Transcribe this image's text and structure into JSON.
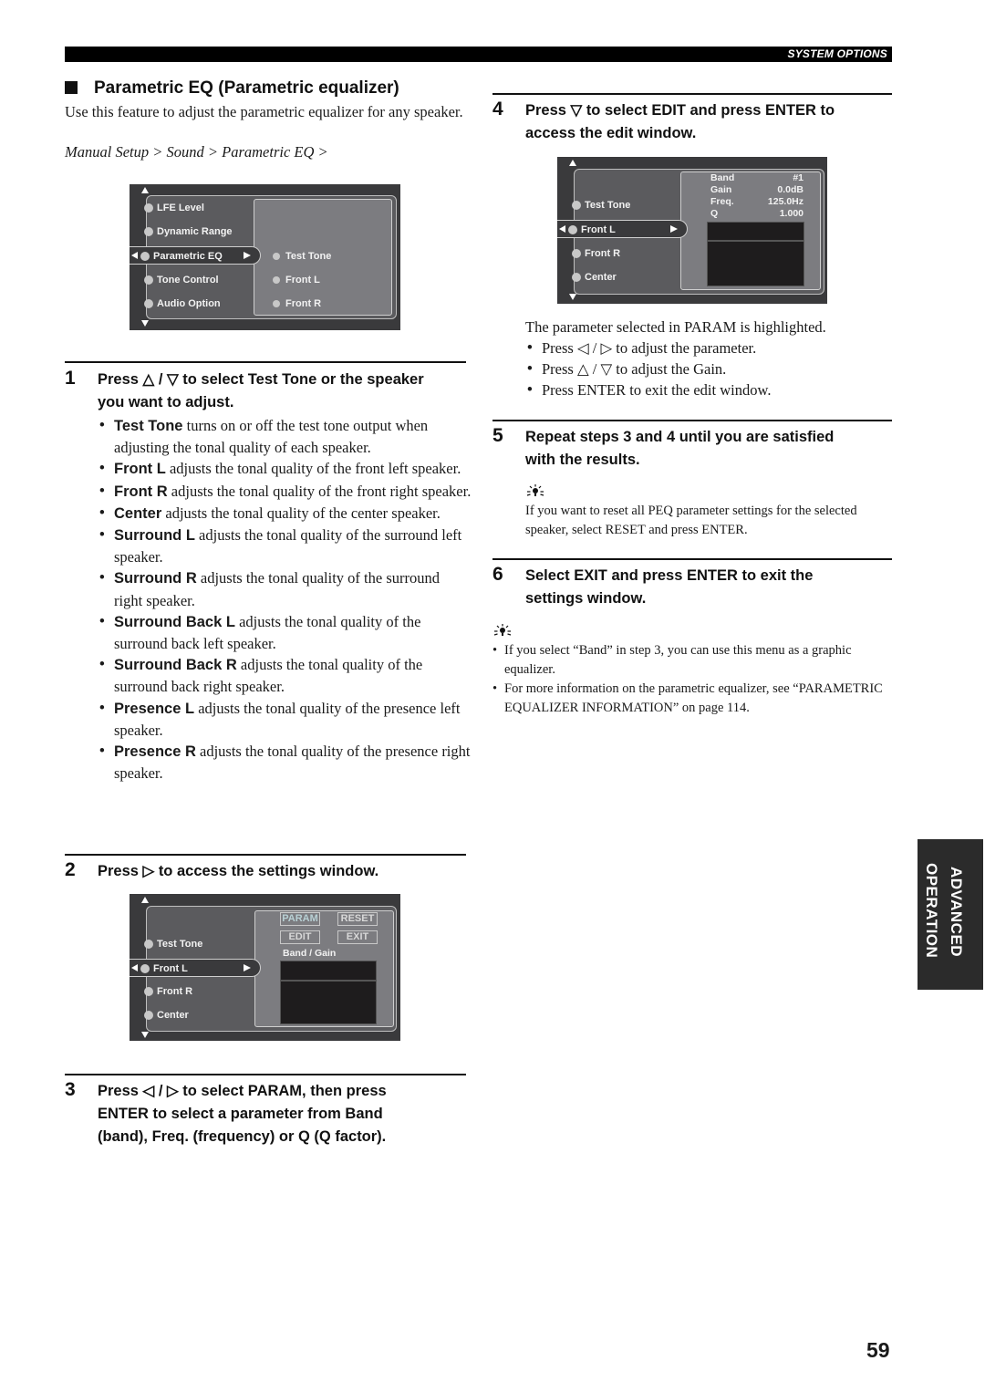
{
  "header": {
    "section_label": "SYSTEM OPTIONS"
  },
  "section": {
    "title": "Parametric EQ (Parametric equalizer)",
    "intro": "Use this feature to adjust the parametric equalizer for any speaker.",
    "breadcrumb": "Manual Setup > Sound > Parametric EQ >"
  },
  "osd_menu": {
    "left_items": [
      "LFE Level",
      "Dynamic Range",
      "Parametric EQ",
      "Tone Control",
      "Audio Option"
    ],
    "selected_index": 2,
    "right_items": [
      "Test Tone",
      "Front L",
      "Front R"
    ]
  },
  "steps": [
    {
      "num": "1",
      "text": "Press △ / ▽ to select Test Tone or the speaker you want to adjust.",
      "line1": "Press △ / ▽ to select Test Tone or the speaker",
      "line2": "you want to adjust.",
      "bullets": [
        {
          "term": "Test Tone",
          "desc": " turns on or off the test tone output when adjusting the tonal quality of each speaker."
        },
        {
          "term": "Front L",
          "desc": " adjusts the tonal quality of the front left speaker."
        },
        {
          "term": "Front R",
          "desc": " adjusts the tonal quality of the front right speaker."
        },
        {
          "term": "Center",
          "desc": " adjusts the tonal quality of the center speaker."
        },
        {
          "term": "Surround L",
          "desc": " adjusts the tonal quality of the surround left speaker."
        },
        {
          "term": "Surround R",
          "desc": " adjusts the tonal quality of the surround right speaker."
        },
        {
          "term": "Surround Back L",
          "desc": " adjusts the tonal quality of the surround back left speaker."
        },
        {
          "term": "Surround Back R",
          "desc": " adjusts the tonal quality of the surround back right speaker."
        },
        {
          "term": "Presence L",
          "desc": " adjusts the tonal quality of the presence left speaker."
        },
        {
          "term": "Presence R",
          "desc": " adjusts the tonal quality of the presence right speaker."
        }
      ]
    },
    {
      "num": "2",
      "line1": "Press ▷ to access the settings window."
    },
    {
      "num": "3",
      "line1": "Press ◁ / ▷ to select PARAM, then press",
      "line2": "ENTER to select a parameter from Band",
      "line3": "(band), Freq. (frequency) or Q (Q factor)."
    },
    {
      "num": "4",
      "line1": "Press ▽ to select EDIT and press ENTER to",
      "line2": "access the edit window.",
      "note": "The parameter selected in PARAM is highlighted.",
      "bullets": [
        "Press ◁ / ▷ to adjust the parameter.",
        "Press △ / ▽ to adjust the Gain.",
        "Press ENTER to exit the edit window."
      ]
    },
    {
      "num": "5",
      "line1": "Repeat steps 3 and 4 until you are satisfied",
      "line2": "with the results.",
      "tip": "If you want to reset all PEQ parameter settings for the selected speaker, select RESET and press ENTER."
    },
    {
      "num": "6",
      "line1": "Select EXIT and press ENTER to exit the",
      "line2": "settings window.",
      "tips": [
        "If you select “Band” in step 3, you can use this menu as a graphic equalizer.",
        "For more information on the parametric equalizer, see “PARAMETRIC EQUALIZER INFORMATION” on page 114."
      ]
    }
  ],
  "osd_settings": {
    "speakers": [
      "Test Tone",
      "Front L",
      "Front R",
      "Center"
    ],
    "selected_index": 1,
    "buttons": {
      "param": "PARAM",
      "reset": "RESET",
      "edit": "EDIT",
      "exit": "EXIT"
    },
    "mode_label": "Band / Gain"
  },
  "osd_edit": {
    "speakers": [
      "Test Tone",
      "Front L",
      "Front R",
      "Center"
    ],
    "selected_index": 1,
    "params": [
      {
        "label": "Band",
        "value": "#1"
      },
      {
        "label": "Gain",
        "value": "0.0dB"
      },
      {
        "label": "Freq.",
        "value": "125.0Hz"
      },
      {
        "label": "Q",
        "value": "1.000"
      }
    ]
  },
  "side_tab": {
    "line1": "ADVANCED",
    "line2": "OPERATION"
  },
  "page_number": "59"
}
